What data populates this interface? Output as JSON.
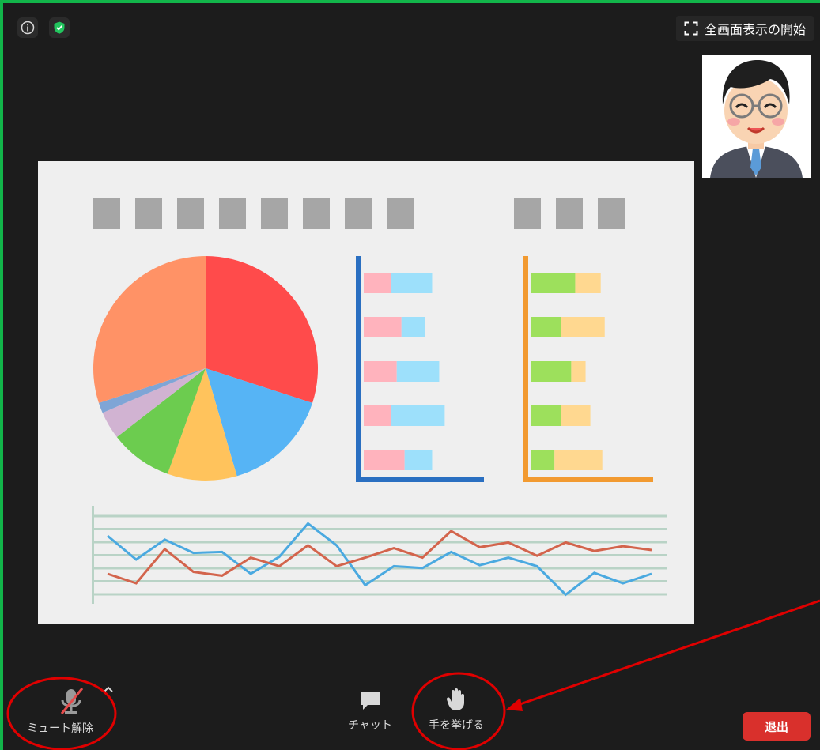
{
  "fullscreen_label": "全画面表示の開始",
  "toolbar": {
    "unmute_label": "ミュート解除",
    "chat_label": "チャット",
    "raise_hand_label": "手を挙げる",
    "leave_label": "退出"
  },
  "shared_screen": {
    "pie_colors": [
      "#ff4b4b",
      "#56b4f5",
      "#ffc35c",
      "#6ccc4f",
      "#d1b3d2",
      "#7fa5d6",
      "#ff9266"
    ],
    "bar_panel_left": {
      "axis_color": "#2a6fc1",
      "segment_colors": [
        "#ffb3bd",
        "#9de0fb"
      ],
      "bars": [
        {
          "a": 0.35,
          "b": 0.52
        },
        {
          "a": 0.48,
          "b": 0.3
        },
        {
          "a": 0.42,
          "b": 0.54
        },
        {
          "a": 0.35,
          "b": 0.68
        },
        {
          "a": 0.52,
          "b": 0.35
        }
      ]
    },
    "bar_panel_right": {
      "axis_color": "#f29a30",
      "segment_colors": [
        "#9de05c",
        "#ffd890"
      ],
      "bars": [
        {
          "a": 0.55,
          "b": 0.32
        },
        {
          "a": 0.37,
          "b": 0.55
        },
        {
          "a": 0.5,
          "b": 0.18
        },
        {
          "a": 0.37,
          "b": 0.37
        },
        {
          "a": 0.29,
          "b": 0.6
        }
      ]
    },
    "line_chart": {
      "colors": [
        "#4aa9e0",
        "#d3644c"
      ],
      "series_a": [
        0.7,
        0.45,
        0.66,
        0.52,
        0.53,
        0.3,
        0.48,
        0.83,
        0.6,
        0.18,
        0.38,
        0.36,
        0.53,
        0.39,
        0.47,
        0.38,
        0.08,
        0.31,
        0.2,
        0.3
      ],
      "series_b": [
        0.3,
        0.2,
        0.56,
        0.32,
        0.28,
        0.47,
        0.38,
        0.6,
        0.38,
        0.47,
        0.57,
        0.47,
        0.75,
        0.58,
        0.63,
        0.49,
        0.63,
        0.54,
        0.59,
        0.55
      ]
    }
  }
}
